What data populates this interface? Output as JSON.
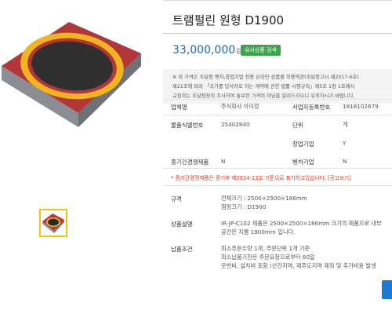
{
  "product": {
    "title": "트램펄린 원형 D1900",
    "price": "33,000,000",
    "price_unit": "원",
    "badge": "유사상품 검색"
  },
  "notes": {
    "line1": "※ 위 가격은 조달청 벤처,창업기업 전용 온라인 상품몰 이용약관(조달청고시 제2017-6호)",
    "line2_prefix": "제21조에 따라 ",
    "line2_red": "「국가를 당사자로 하는 계약에 관한 법률 시행규칙」제5조 1항 1호에서",
    "line3_red": "규정하는 조달청장이 조사하여 통보한 가격이 아님을 알려드리오니 유의",
    "line3_suffix": "하시기 바랍니다."
  },
  "info": {
    "supplier_label": "업체명",
    "supplier_value": "주식회사 아이랑",
    "bizno_label": "사업자등록번호",
    "bizno_value": "1818102679",
    "item_id_label": "물품식별번호",
    "item_id_value": "25402840",
    "unit_label": "단위",
    "unit_value": "개",
    "startup_label": "창업기업",
    "startup_value": "Y",
    "sme_label": "중기간경쟁제품",
    "sme_value": "N",
    "venture_label": "벤처기업",
    "venture_value": "N"
  },
  "sme_notice": "* 중기간경쟁제품은 중기부 제2024-13호 기준으로 표기하고있습니다. [공고보기]",
  "details": {
    "spec_label": "규격",
    "spec_line1": "전체크기 : 2500×2500×186mm",
    "spec_line2": "점핑크기 : D1900",
    "desc_label": "상품설명",
    "desc_line1": "IR-JP-C102 제품은 2500×2500×186mm 크기의 제품으로 내부",
    "desc_line2": "공간은 지름 1900mm 입니다.",
    "delivery_label": "납품조건",
    "delivery_line1": "최소주문수량 1개, 주문단위 1개 기준",
    "delivery_line2": "최소납품기한은 주문요청으로부터 60일",
    "delivery_line3": "운반비, 설치비 포함 (산간지역, 제주도지역 제외 및 추가비용 발생"
  },
  "colors": {
    "price": "#1f66b5",
    "badge": "#3aa54a",
    "warning": "#d12a1a",
    "thumb_border": "#f2c20e",
    "action_button": "#1a7ad6"
  }
}
